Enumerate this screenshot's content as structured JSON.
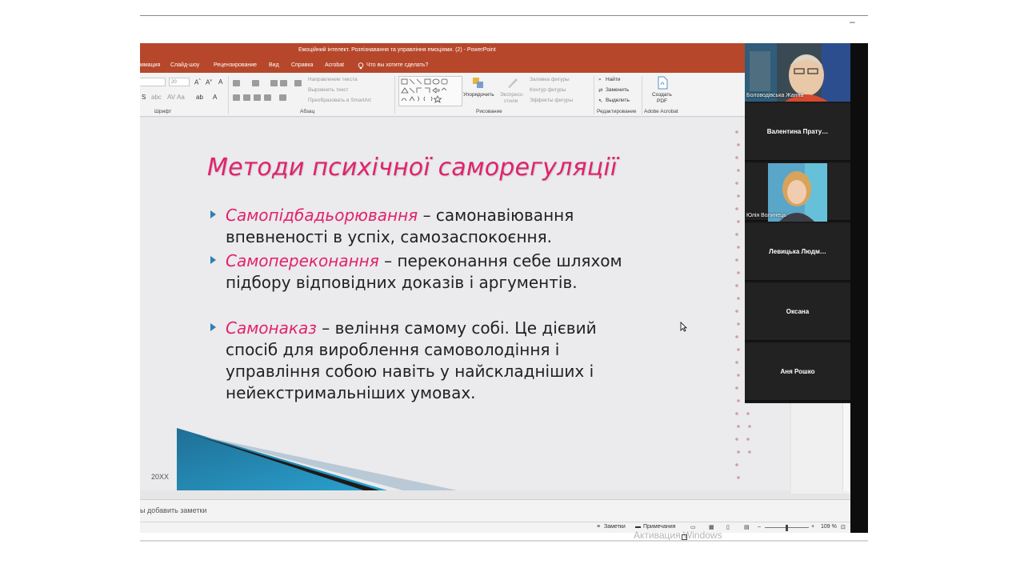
{
  "window": {
    "title": "Емоційний інтелект. Розпізнавання та управління емоціями. (2)  -  PowerPoint",
    "minimize_glyph": "–"
  },
  "tabs": [
    "ммация",
    "Слайд-шоу",
    "Рецензирование",
    "Вид",
    "Справка",
    "Acrobat",
    "Что вы хотите сделать?"
  ],
  "ribbon": {
    "font_size": "20",
    "groups": {
      "font": "Шрифт",
      "paragraph": "Абзац",
      "drawing": "Рисование",
      "editing": "Редактирование",
      "acrobat": "Adobe Acrobat"
    },
    "paragraph_items": [
      "Направление текста",
      "Выровнять текст",
      "Преобразовать в SmartArt"
    ],
    "arrange": "Упорядочить",
    "quick_styles": [
      "Экспресс-",
      "стили"
    ],
    "shape_items": [
      "Заливка фигуры",
      "Контур фигуры",
      "Эффекты фигуры"
    ],
    "editing_items": [
      "Найти",
      "Заменить",
      "Выделить"
    ],
    "create_pdf": [
      "Создать",
      "PDF"
    ]
  },
  "slide": {
    "title": "Методи психічної саморегуляції",
    "bullets": [
      {
        "term": "Самопідбадьорювання",
        "text": " – самонавіювання впевненості в успіх, самозаспокоєння."
      },
      {
        "term": "Самопереконання",
        "text": " – переконання себе шляхом підбору відповідних доказів і аргументів."
      },
      {
        "term": "Самонаказ",
        "text": " – веління самому собі. Це дієвий спосіб для вироблення самоволодіння і управління собою навіть у найскладніших і нейекстримальніших умовах."
      }
    ],
    "footer": "20XX"
  },
  "notes_placeholder": "ы добавить заметки",
  "status": {
    "notes": "Заметки",
    "comments": "Примечания",
    "zoom": "109 %"
  },
  "watermark": "Активация Windows",
  "participants": [
    {
      "name": "Боловодівська Жанна",
      "video": true
    },
    {
      "name": "Валентина  Прату…",
      "video": false
    },
    {
      "name": "Юлія Волинець",
      "video": true
    },
    {
      "name": "Левицька  Людм…",
      "video": false
    },
    {
      "name": "Оксана",
      "video": false
    },
    {
      "name": "Аня Рошко",
      "video": false
    }
  ],
  "colors": {
    "accent": "#b7472a",
    "title_pink": "#e0236d",
    "bullet_blue": "#2f7fb5"
  }
}
